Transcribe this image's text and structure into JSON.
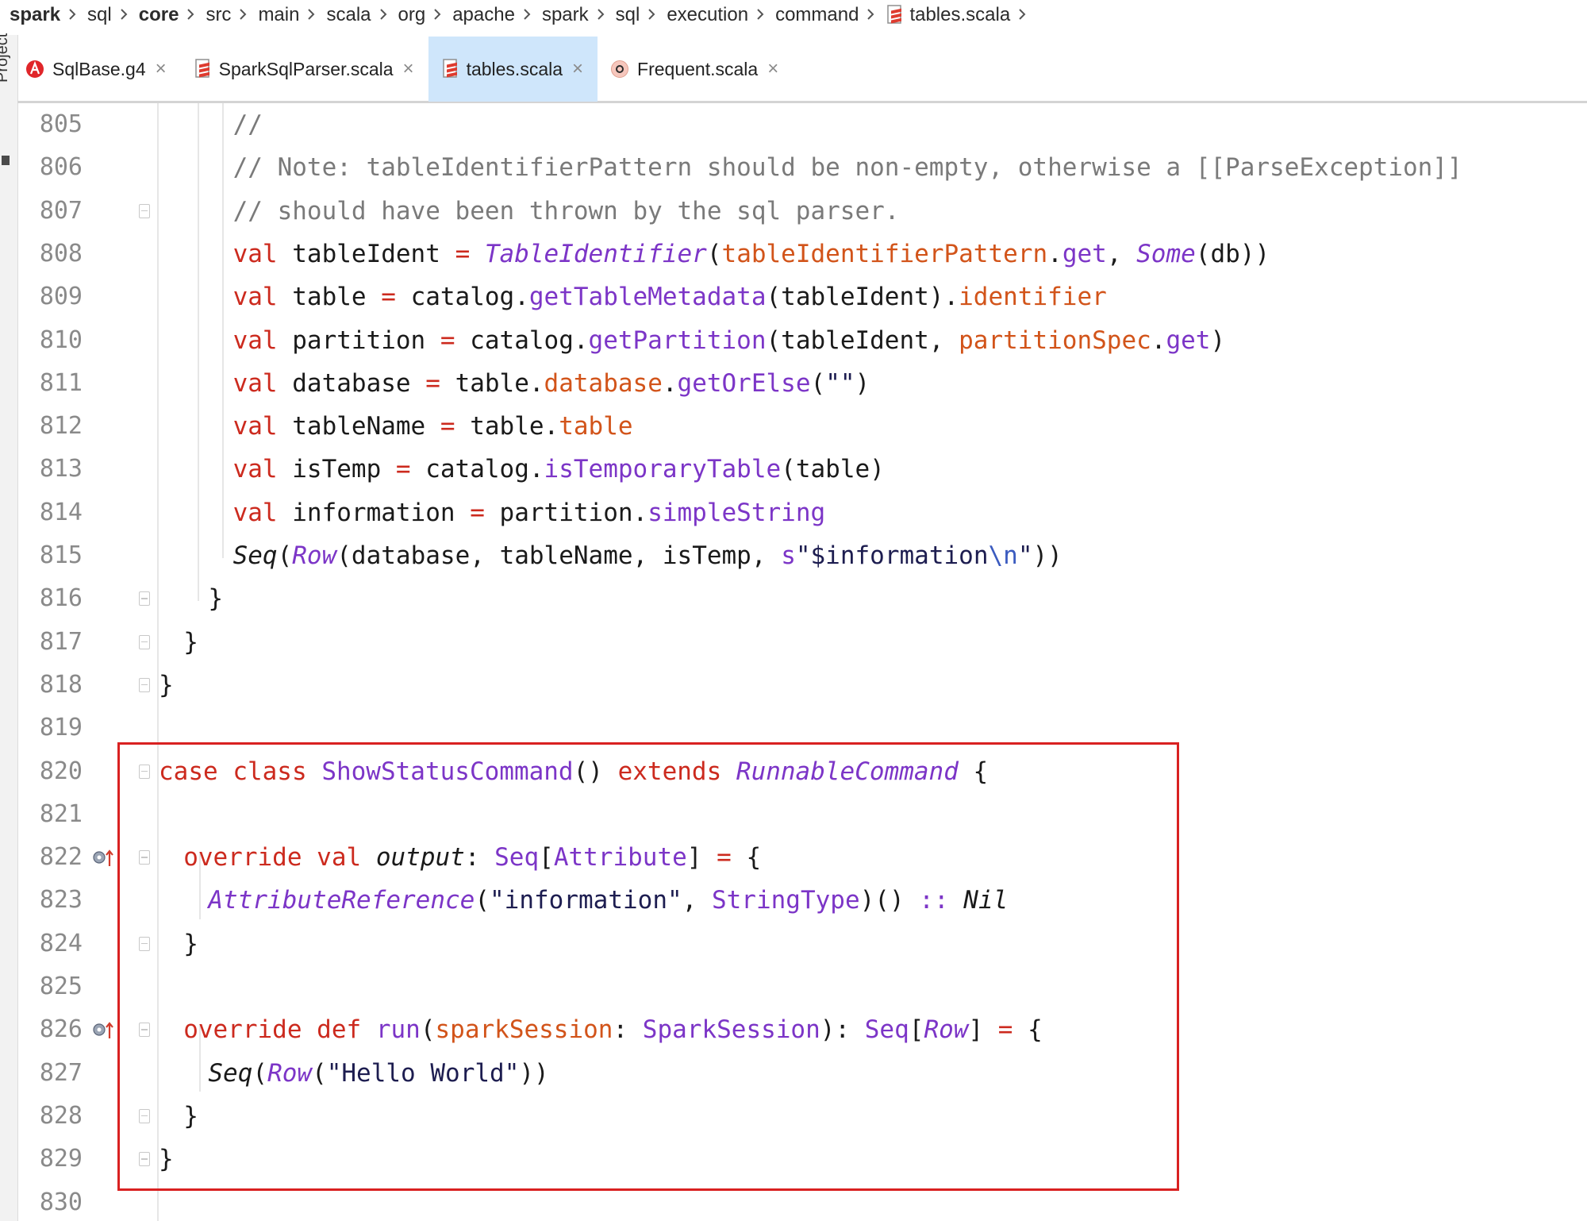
{
  "breadcrumb": [
    "spark",
    "sql",
    "core",
    "src",
    "main",
    "scala",
    "org",
    "apache",
    "spark",
    "sql",
    "execution",
    "command",
    "tables.scala"
  ],
  "side_panel": {
    "label": "Project"
  },
  "tabs": [
    {
      "label": "SqlBase.g4",
      "icon": "antlr-icon",
      "active": false
    },
    {
      "label": "SparkSqlParser.scala",
      "icon": "scala-file-icon",
      "active": false
    },
    {
      "label": "tables.scala",
      "icon": "scala-file-icon",
      "active": true
    },
    {
      "label": "Frequent.scala",
      "icon": "scala-object-icon",
      "active": false
    }
  ],
  "close_glyph": "×",
  "editor": {
    "lines": [
      {
        "num": "805",
        "indent": 6,
        "tokens": [
          {
            "t": "//",
            "c": "cm"
          }
        ]
      },
      {
        "num": "806",
        "indent": 6,
        "tokens": [
          {
            "t": "// Note: tableIdentifierPattern should be non-empty, otherwise a [[ParseException]]",
            "c": "cm"
          }
        ]
      },
      {
        "num": "807",
        "indent": 6,
        "tokens": [
          {
            "t": "// should have been thrown by the sql parser.",
            "c": "cm"
          }
        ]
      },
      {
        "num": "808",
        "indent": 6,
        "tokens": [
          {
            "t": "val ",
            "c": "kw"
          },
          {
            "t": "tableIdent "
          },
          {
            "t": "= ",
            "c": "op"
          },
          {
            "t": "TableIdentifier",
            "c": "tyi"
          },
          {
            "t": "("
          },
          {
            "t": "tableIdentifierPattern",
            "c": "fld"
          },
          {
            "t": "."
          },
          {
            "t": "get",
            "c": "mth"
          },
          {
            "t": ", "
          },
          {
            "t": "Some",
            "c": "tyi"
          },
          {
            "t": "(db))"
          }
        ]
      },
      {
        "num": "809",
        "indent": 6,
        "tokens": [
          {
            "t": "val ",
            "c": "kw"
          },
          {
            "t": "table "
          },
          {
            "t": "= ",
            "c": "op"
          },
          {
            "t": "catalog."
          },
          {
            "t": "getTableMetadata",
            "c": "mth"
          },
          {
            "t": "(tableIdent)."
          },
          {
            "t": "identifier",
            "c": "fld"
          }
        ]
      },
      {
        "num": "810",
        "indent": 6,
        "tokens": [
          {
            "t": "val ",
            "c": "kw"
          },
          {
            "t": "partition "
          },
          {
            "t": "= ",
            "c": "op"
          },
          {
            "t": "catalog."
          },
          {
            "t": "getPartition",
            "c": "mth"
          },
          {
            "t": "(tableIdent, "
          },
          {
            "t": "partitionSpec",
            "c": "fld"
          },
          {
            "t": "."
          },
          {
            "t": "get",
            "c": "mth"
          },
          {
            "t": ")"
          }
        ]
      },
      {
        "num": "811",
        "indent": 6,
        "tokens": [
          {
            "t": "val ",
            "c": "kw"
          },
          {
            "t": "database "
          },
          {
            "t": "= ",
            "c": "op"
          },
          {
            "t": "table."
          },
          {
            "t": "database",
            "c": "fld"
          },
          {
            "t": "."
          },
          {
            "t": "getOrElse",
            "c": "mth"
          },
          {
            "t": "("
          },
          {
            "t": "\"\"",
            "c": "str"
          },
          {
            "t": ")"
          }
        ]
      },
      {
        "num": "812",
        "indent": 6,
        "tokens": [
          {
            "t": "val ",
            "c": "kw"
          },
          {
            "t": "tableName "
          },
          {
            "t": "= ",
            "c": "op"
          },
          {
            "t": "table."
          },
          {
            "t": "table",
            "c": "fld"
          }
        ]
      },
      {
        "num": "813",
        "indent": 6,
        "tokens": [
          {
            "t": "val ",
            "c": "kw"
          },
          {
            "t": "isTemp "
          },
          {
            "t": "= ",
            "c": "op"
          },
          {
            "t": "catalog."
          },
          {
            "t": "isTemporaryTable",
            "c": "mth"
          },
          {
            "t": "(table)"
          }
        ]
      },
      {
        "num": "814",
        "indent": 6,
        "tokens": [
          {
            "t": "val ",
            "c": "kw"
          },
          {
            "t": "information "
          },
          {
            "t": "= ",
            "c": "op"
          },
          {
            "t": "partition."
          },
          {
            "t": "simpleString",
            "c": "mth"
          }
        ]
      },
      {
        "num": "815",
        "indent": 6,
        "tokens": [
          {
            "t": "Seq",
            "c": "it"
          },
          {
            "t": "("
          },
          {
            "t": "Row",
            "c": "tyi"
          },
          {
            "t": "(database, tableName, isTemp, "
          },
          {
            "t": "s",
            "c": "mth"
          },
          {
            "t": "\"$information",
            "c": "str"
          },
          {
            "t": "\\n",
            "c": "esc"
          },
          {
            "t": "\"",
            "c": "str"
          },
          {
            "t": "))"
          }
        ]
      },
      {
        "num": "816",
        "indent": 4,
        "tokens": [
          {
            "t": "}"
          }
        ]
      },
      {
        "num": "817",
        "indent": 2,
        "tokens": [
          {
            "t": "}"
          }
        ]
      },
      {
        "num": "818",
        "indent": 0,
        "tokens": [
          {
            "t": "}"
          }
        ]
      },
      {
        "num": "819",
        "indent": 0,
        "tokens": []
      },
      {
        "num": "820",
        "indent": 0,
        "tokens": [
          {
            "t": "case class ",
            "c": "kw"
          },
          {
            "t": "ShowStatusCommand",
            "c": "ty"
          },
          {
            "t": "() "
          },
          {
            "t": "extends ",
            "c": "kw"
          },
          {
            "t": "RunnableCommand",
            "c": "tyi"
          },
          {
            "t": " {"
          }
        ]
      },
      {
        "num": "821",
        "indent": 0,
        "tokens": []
      },
      {
        "num": "822",
        "indent": 2,
        "tokens": [
          {
            "t": "override val ",
            "c": "kw"
          },
          {
            "t": "output",
            "c": "it"
          },
          {
            "t": ": "
          },
          {
            "t": "Seq",
            "c": "ty"
          },
          {
            "t": "["
          },
          {
            "t": "Attribute",
            "c": "ty"
          },
          {
            "t": "] "
          },
          {
            "t": "= ",
            "c": "op"
          },
          {
            "t": "{"
          }
        ]
      },
      {
        "num": "823",
        "indent": 4,
        "tokens": [
          {
            "t": "AttributeReference",
            "c": "tyi"
          },
          {
            "t": "("
          },
          {
            "t": "\"information\"",
            "c": "str"
          },
          {
            "t": ", "
          },
          {
            "t": "StringType",
            "c": "ty"
          },
          {
            "t": ")() "
          },
          {
            "t": ":: ",
            "c": "mth"
          },
          {
            "t": "Nil",
            "c": "it"
          }
        ]
      },
      {
        "num": "824",
        "indent": 2,
        "tokens": [
          {
            "t": "}"
          }
        ]
      },
      {
        "num": "825",
        "indent": 0,
        "tokens": []
      },
      {
        "num": "826",
        "indent": 2,
        "tokens": [
          {
            "t": "override def ",
            "c": "kw"
          },
          {
            "t": "run",
            "c": "ty"
          },
          {
            "t": "("
          },
          {
            "t": "sparkSession",
            "c": "fld"
          },
          {
            "t": ": "
          },
          {
            "t": "SparkSession",
            "c": "ty"
          },
          {
            "t": "): "
          },
          {
            "t": "Seq",
            "c": "ty"
          },
          {
            "t": "["
          },
          {
            "t": "Row",
            "c": "tyi"
          },
          {
            "t": "] "
          },
          {
            "t": "= ",
            "c": "op"
          },
          {
            "t": "{"
          }
        ]
      },
      {
        "num": "827",
        "indent": 4,
        "tokens": [
          {
            "t": "Seq",
            "c": "it"
          },
          {
            "t": "("
          },
          {
            "t": "Row",
            "c": "tyi"
          },
          {
            "t": "("
          },
          {
            "t": "\"Hello World\"",
            "c": "str"
          },
          {
            "t": "))"
          }
        ]
      },
      {
        "num": "828",
        "indent": 2,
        "tokens": [
          {
            "t": "}"
          }
        ]
      },
      {
        "num": "829",
        "indent": 0,
        "tokens": [
          {
            "t": "}"
          }
        ]
      },
      {
        "num": "830",
        "indent": 0,
        "tokens": []
      }
    ],
    "fold_markers": [
      "807",
      "816",
      "817",
      "818",
      "820",
      "822",
      "824",
      "826",
      "828",
      "829"
    ],
    "override_markers": [
      "822",
      "826"
    ]
  },
  "colors": {
    "keyword": "#cc2a1e",
    "comment": "#7a7a7a",
    "type": "#7c35c7",
    "field": "#d2541a",
    "active_tab": "#cfe6fb",
    "highlight_box": "#d92121"
  }
}
